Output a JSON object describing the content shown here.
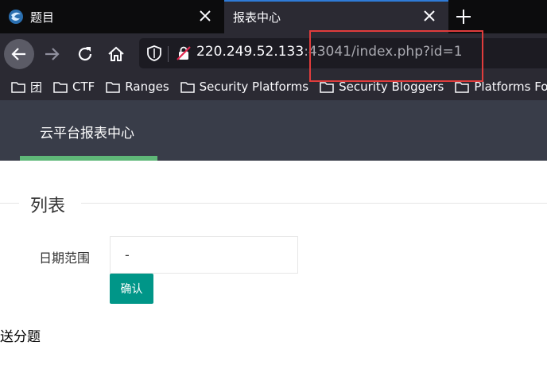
{
  "browser": {
    "tabs": [
      {
        "title": "题目",
        "active": false
      },
      {
        "title": "报表中心",
        "active": true
      }
    ],
    "url": {
      "host": "220.249.52.133",
      "rest": ":43041/index.php?id=1"
    },
    "bookmarks": [
      "团",
      "CTF",
      "Ranges",
      "Security Platforms",
      "Security Bloggers",
      "Platforms For"
    ],
    "icons": {
      "favicon": "globe-favicon-icon",
      "close": "close-icon",
      "new_tab": "plus-icon",
      "back": "arrow-left-icon",
      "forward": "arrow-right-icon",
      "reload": "reload-icon",
      "home": "home-icon",
      "shield": "shield-icon",
      "insecure": "insecure-lock-icon",
      "folder": "folder-icon"
    }
  },
  "page": {
    "header_title": "云平台报表中心",
    "section_title": "列表",
    "date_label": "日期范围",
    "date_value": "-",
    "confirm_label": "确认",
    "footer_text": "送分题"
  },
  "colors": {
    "header_bg": "#393d49",
    "accent_green": "#5fb878",
    "button_teal": "#009688",
    "annotation_red": "#e03c3c"
  }
}
